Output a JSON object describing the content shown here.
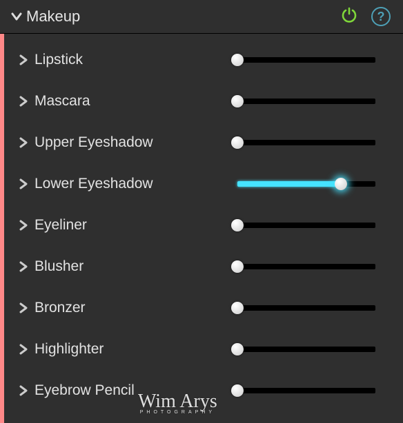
{
  "header": {
    "title": "Makeup",
    "power_color": "#7fd63a",
    "help_glyph": "?"
  },
  "accent_bar_color": "#ff8888",
  "slider_track_color": "#000000",
  "slider_fill_color": "#46e3ff",
  "sliders": [
    {
      "label": "Lipstick",
      "value": 0,
      "active": false
    },
    {
      "label": "Mascara",
      "value": 0,
      "active": false
    },
    {
      "label": "Upper Eyeshadow",
      "value": 0,
      "active": false
    },
    {
      "label": "Lower Eyeshadow",
      "value": 75,
      "active": true
    },
    {
      "label": "Eyeliner",
      "value": 0,
      "active": false
    },
    {
      "label": "Blusher",
      "value": 0,
      "active": false
    },
    {
      "label": "Bronzer",
      "value": 0,
      "active": false
    },
    {
      "label": "Highlighter",
      "value": 0,
      "active": false
    },
    {
      "label": "Eyebrow Pencil",
      "value": 0,
      "active": false
    }
  ],
  "watermark": {
    "name": "Wim Arys",
    "sub": "PHOTOGRAPHY"
  }
}
